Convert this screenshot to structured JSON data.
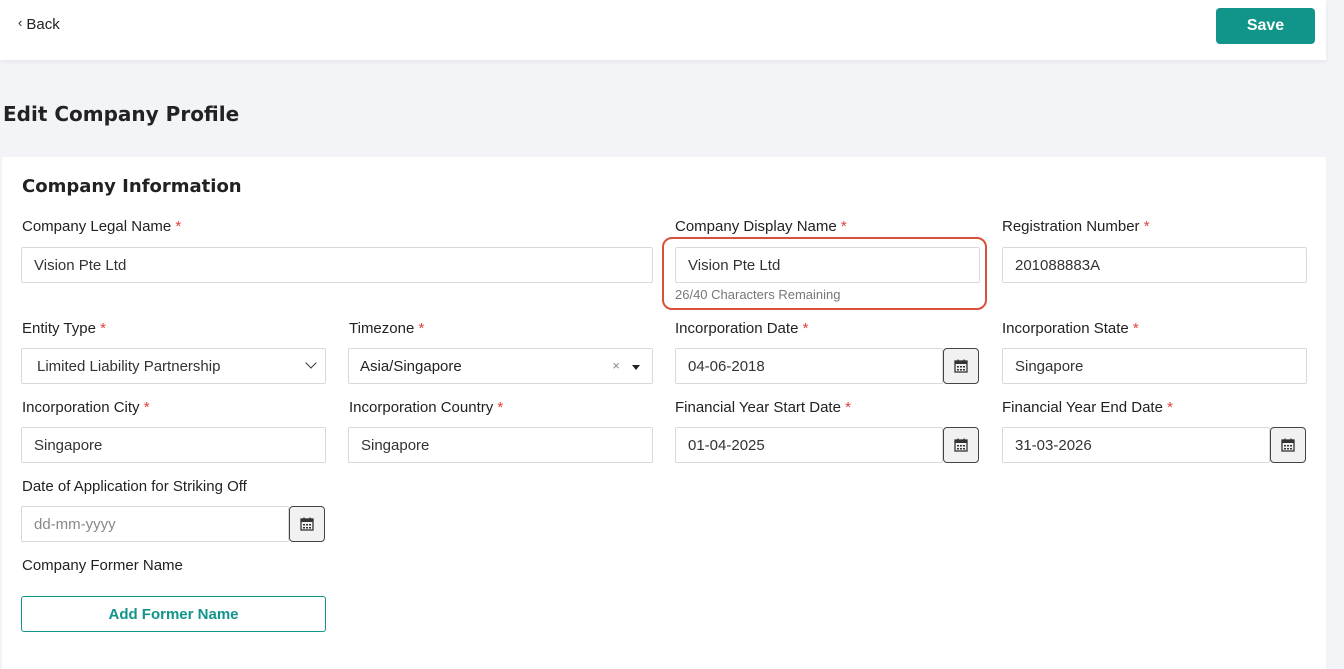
{
  "header": {
    "back_label": "Back",
    "save_label": "Save"
  },
  "page": {
    "title": "Edit Company Profile"
  },
  "section": {
    "title": "Company Information"
  },
  "required_mark": "*",
  "fields": {
    "legal_name": {
      "label": "Company Legal Name",
      "value": "Vision Pte Ltd"
    },
    "display_name": {
      "label": "Company Display Name",
      "value": "Vision Pte Ltd",
      "counter": "26/40 Characters Remaining"
    },
    "registration_number": {
      "label": "Registration Number",
      "value": "201088883A"
    },
    "entity_type": {
      "label": "Entity Type",
      "value": "Limited Liability Partnership"
    },
    "timezone": {
      "label": "Timezone",
      "value": "Asia/Singapore",
      "clear": "×"
    },
    "incorporation_date": {
      "label": "Incorporation Date",
      "value": "04-06-2018"
    },
    "incorporation_state": {
      "label": "Incorporation State",
      "value": "Singapore"
    },
    "incorporation_city": {
      "label": "Incorporation City",
      "value": "Singapore"
    },
    "incorporation_country": {
      "label": "Incorporation Country",
      "value": "Singapore"
    },
    "fy_start": {
      "label": "Financial Year Start Date",
      "value": "01-04-2025"
    },
    "fy_end": {
      "label": "Financial Year End Date",
      "value": "31-03-2026"
    },
    "striking_off": {
      "label": "Date of Application for Striking Off",
      "placeholder": "dd-mm-yyyy"
    },
    "former_name": {
      "label": "Company Former Name",
      "button_label": "Add Former Name"
    }
  },
  "colors": {
    "accent": "#11958a",
    "required": "#e0403a",
    "highlight": "#d9513a"
  }
}
